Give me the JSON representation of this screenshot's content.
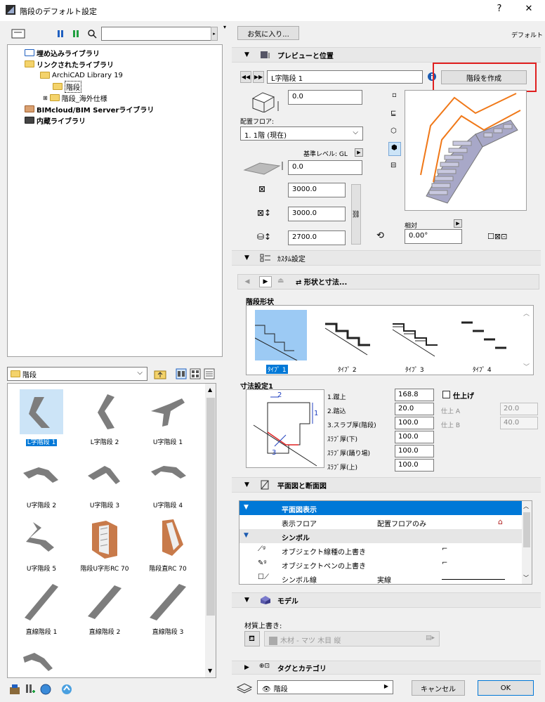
{
  "window": {
    "title": "階段のデフォルト設定",
    "help": "?",
    "close": "✕"
  },
  "left": {
    "tree": [
      {
        "label": "埋め込みライブラリ"
      },
      {
        "label": "リンクされたライブラリ"
      },
      {
        "label": "ArchiCAD Library 19"
      },
      {
        "label": "階段"
      },
      {
        "label": "階段_海外仕様"
      },
      {
        "label": "BIMcloud/BIM Serverライブラリ"
      },
      {
        "label": "内蔵ライブラリ"
      }
    ],
    "folder_select": "階段",
    "items": [
      {
        "label": "L字階段 1"
      },
      {
        "label": "L字階段 2"
      },
      {
        "label": "U字階段 1"
      },
      {
        "label": "U字階段 2"
      },
      {
        "label": "U字階段 3"
      },
      {
        "label": "U字階段 4"
      },
      {
        "label": "U字階段 5"
      },
      {
        "label": "階段U字形RC 70"
      },
      {
        "label": "階段直RC 70"
      },
      {
        "label": "直線階段 1"
      },
      {
        "label": "直線階段 2"
      },
      {
        "label": "直線階段 3"
      }
    ]
  },
  "right": {
    "favorites": "お気に入り...",
    "default_label": "デフォルト",
    "preview": {
      "section": "プレビューと位置",
      "name": "L字階段 1",
      "create_btn": "階段を作成",
      "offset": "0.0",
      "floor_label": "配置フロア:",
      "floor_value": "1. 1階 (現在)",
      "base_level": "基準レベル: GL",
      "elev": "0.0",
      "width": "3000.0",
      "depth": "3000.0",
      "height": "2700.0",
      "relative": "相対",
      "angle": "0.00°"
    },
    "custom": {
      "section": "ｶｽﾀﾑ設定",
      "nav": "形状と寸法...",
      "shape_label": "階段形状",
      "types": [
        "ﾀｲﾌﾟ 1",
        "ﾀｲﾌﾟ 2",
        "ﾀｲﾌﾟ 3",
        "ﾀｲﾌﾟ 4"
      ],
      "dim_label": "寸法設定1",
      "dims": [
        {
          "label": "1.蹴上",
          "value": "168.8"
        },
        {
          "label": "2.踏込",
          "value": "20.0"
        },
        {
          "label": "3.スラブ厚(階段)",
          "value": "100.0"
        },
        {
          "label": "ｽﾗﾌﾞ厚(下)",
          "value": "100.0"
        },
        {
          "label": "ｽﾗﾌﾞ厚(踊り場)",
          "value": "100.0"
        },
        {
          "label": "ｽﾗﾌﾞ厚(上)",
          "value": "100.0"
        }
      ],
      "finish": "仕上げ",
      "finish_a": "仕上 A",
      "finish_a_val": "20.0",
      "finish_b": "仕上 B",
      "finish_b_val": "40.0"
    },
    "plan": {
      "section": "平面図と断面図",
      "rows": [
        {
          "label": "平面図表示",
          "value": ""
        },
        {
          "label": "表示フロア",
          "value": "配置フロアのみ"
        },
        {
          "label": "シンボル",
          "value": ""
        },
        {
          "label": "オブジェクト線種の上書き",
          "value": ""
        },
        {
          "label": "オブジェクトペンの上書き",
          "value": ""
        },
        {
          "label": "シンボル線",
          "value": "実線"
        }
      ]
    },
    "model": {
      "section": "モデル",
      "material_label": "材質上書き:",
      "material_value": "木材 - マツ 木目 縦"
    },
    "tags": {
      "section": "タグとカテゴリ"
    },
    "bottom": {
      "layer": "階段",
      "cancel": "キャンセル",
      "ok": "OK"
    }
  }
}
